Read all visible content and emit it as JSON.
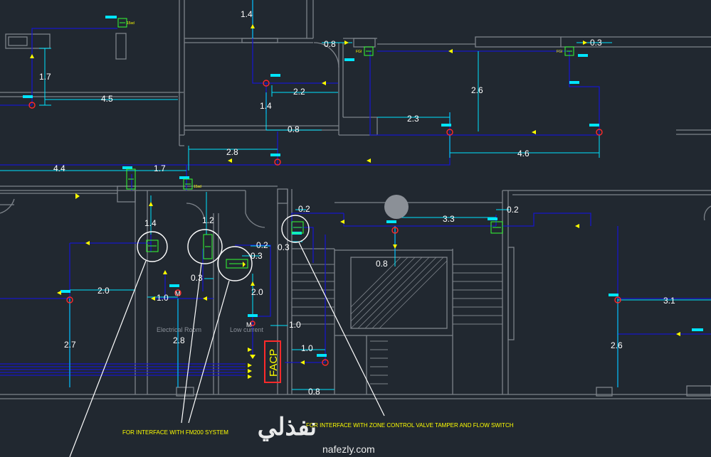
{
  "dimensions": [
    "1.4",
    "0.8",
    "0.3",
    "1.7",
    "4.5",
    "2.2",
    "1.4",
    "0.8",
    "2.6",
    "2.3",
    "4.6",
    "2.8",
    "4.4",
    "1.7",
    "1.2",
    "1.4",
    "0.2",
    "0.3",
    "0.3",
    "0.2",
    "3.3",
    "0.2",
    "0.8",
    "2.0",
    "1.0",
    "2.0",
    "1.0",
    "1.0",
    "2.7",
    "2.8",
    "3.1",
    "2.6",
    "0.8"
  ],
  "rooms": {
    "electrical": "Electrical Room",
    "low_current": "Low current"
  },
  "panel": {
    "label": "FACP"
  },
  "notes": {
    "fm200": "FOR INTERFACE WITH FM200 SYSTEM",
    "zone_control": "FOR INTERFACE WITH ZONE CONTROL VALVE TAMPER AND FLOW SWITCH"
  },
  "watermark": {
    "arabic": "نفذلي",
    "url": "nafezly.com"
  },
  "colors": {
    "background": "#212830",
    "wall": "#7d838a",
    "wire": "#1717c8",
    "dimension": "#00e5ff",
    "device": "#ff2a2a",
    "module": "#33ff33",
    "annotation": "#ffff00"
  }
}
